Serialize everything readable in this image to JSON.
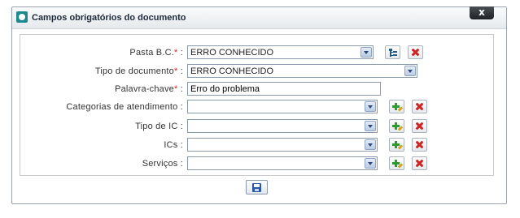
{
  "dialog": {
    "title": "Campos obrigatórios do documento",
    "close_label": "x"
  },
  "form": {
    "required_mark": "*",
    "separator": ":",
    "pasta": {
      "label": "Pasta B.C.",
      "value": "ERRO CONHECIDO"
    },
    "tipo_documento": {
      "label": "Tipo de documento",
      "value": "ERRO CONHECIDO"
    },
    "palavra_chave": {
      "label": "Palavra-chave",
      "value": "Erro do problema"
    },
    "categorias": {
      "label": "Categorias de atendimento",
      "value": ""
    },
    "tipo_ic": {
      "label": "Tipo de IC",
      "value": ""
    },
    "ics": {
      "label": "ICs",
      "value": ""
    },
    "servicos": {
      "label": "Serviços",
      "value": ""
    }
  },
  "icons": {
    "close": "close-icon",
    "tree": "tree-view-icon",
    "delete": "delete-icon",
    "add": "add-edit-icon",
    "save": "save-icon"
  },
  "colors": {
    "required": "#e02020",
    "delete": "#d72121",
    "add": "#2e9a2e",
    "brand": "#1b8a8f"
  }
}
